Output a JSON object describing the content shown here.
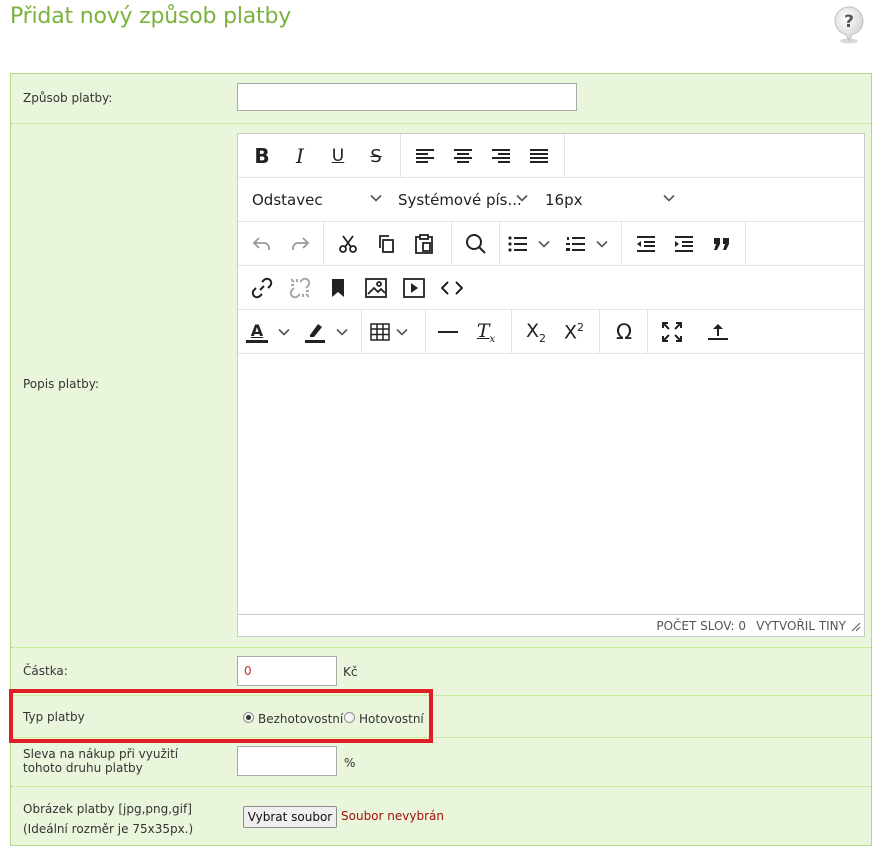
{
  "page": {
    "title": "Přidat nový způsob platby",
    "help_symbol": "?"
  },
  "colors": {
    "title": "#7ab23c",
    "form_background": "#eaf6dc",
    "form_border": "#b4d98b",
    "highlight": "#e01e26",
    "amount_text": "#c03030",
    "file_status_text": "#a01010"
  },
  "form": {
    "payment_method": {
      "label": "Způsob platby:",
      "value": "",
      "placeholder": ""
    },
    "description": {
      "label": "Popis platby:"
    },
    "amount": {
      "label": "Částka:",
      "value": "0",
      "unit": "Kč"
    },
    "payment_type": {
      "label": "Typ platby",
      "options": [
        {
          "label": "Bezhotovostní",
          "checked": true
        },
        {
          "label": "Hotovostní",
          "checked": false
        }
      ]
    },
    "discount": {
      "label": "Sleva na nákup při využití tohoto druhu platby",
      "value": "",
      "unit": "%"
    },
    "image": {
      "label": "Obrázek platby [jpg,png,gif]",
      "hint": "(Ideální rozměr je 75x35px.)",
      "button_label": "Vybrat soubor",
      "status": "Soubor nevybrán"
    }
  },
  "editor": {
    "block_format": "Odstavec",
    "font_family": "Systémové pís...",
    "font_size": "16px",
    "word_count": "POČET SLOV: 0",
    "powered_by": "VYTVOŘIL TINY",
    "toolbar_icons": [
      [
        "bold-icon",
        "italic-icon",
        "underline-icon",
        "strikethrough-icon",
        "align-left-icon",
        "align-center-icon",
        "align-right-icon",
        "align-justify-icon"
      ],
      [
        "undo-icon",
        "redo-icon",
        "cut-icon",
        "copy-icon",
        "paste-icon",
        "search-icon",
        "bullet-list-icon",
        "numbered-list-icon",
        "outdent-icon",
        "indent-icon",
        "blockquote-icon"
      ],
      [
        "link-icon",
        "unlink-icon",
        "bookmark-icon",
        "image-icon",
        "media-icon",
        "code-icon"
      ],
      [
        "text-color-icon",
        "highlight-color-icon",
        "table-icon",
        "horizontal-rule-icon",
        "clear-formatting-icon",
        "subscript-icon",
        "superscript-icon",
        "special-character-icon",
        "fullscreen-icon",
        "insert-icon"
      ]
    ],
    "toolbar_glyphs": {
      "bold": "B",
      "italic": "I",
      "underline": "U",
      "strike": "S",
      "omega": "Ω",
      "subscript_base": "X",
      "subscript_index": "2",
      "superscript_index": "2",
      "text_color_letter": "A",
      "clear_format_letter": "T",
      "clear_format_index": "x"
    }
  }
}
